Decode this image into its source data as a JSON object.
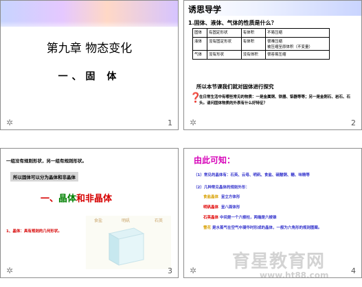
{
  "slides": [
    {
      "number": "1",
      "title": "第九章  物态变化",
      "subtitle": "一、固 体"
    },
    {
      "number": "2",
      "heading": "诱思导学",
      "question": "1.固体、液体、气体的性质是什么？",
      "table": [
        [
          "固体",
          "有固定形状",
          "有体积",
          "不易压缩"
        ],
        [
          "液体",
          "没有固定形状",
          "有体积",
          "很难压缩"
        ],
        [
          "气体",
          "没有形状",
          "没有体积",
          "很容易压缩"
        ]
      ],
      "row_extra": "被压缩至原体积（不变量）",
      "tail": "所以本节课我们就对固体进行探究",
      "question_mark": "❓",
      "paragraph": "在日常生活中有哪些常见的物质：一是金属铜、铁器、铝器等等；另一是金刚石、岩石、石头。请问固体物质的外表有什么好特征？"
    },
    {
      "number": "3",
      "line1": "一组没有规则形状，另一组有规则形状。",
      "box": "所以固体可以分为晶体和非晶体",
      "title_prefix": "一、",
      "title_green": "晶体",
      "title_red": "和非晶体",
      "note": "1、晶体：具有规则的几何形状。",
      "cube_labels": [
        "食盐",
        "明矾",
        "石英"
      ]
    },
    {
      "number": "4",
      "heading": "由此可知：",
      "line1": "（1）常见的晶体有：石英、云母、明矾、食盐、硫酸铜、糖、味精等",
      "line2": "（2）几种常见晶体的规则外形：",
      "items": [
        {
          "k": "食盐晶体",
          "v": "呈立方体形"
        },
        {
          "k": "明矾晶体",
          "v": "呈八面体形"
        },
        {
          "k": "石英晶体",
          "v": "中间是一个六棱柱，两端是六棱锥"
        },
        {
          "k": "雪花",
          "v": "是水蒸气在空气中凝华时形成的晶体，一般为六角形的规则图案。"
        }
      ],
      "watermark": "育星教育网",
      "watermark_url": "www.ht88.com"
    }
  ],
  "star_glyph": "✲"
}
